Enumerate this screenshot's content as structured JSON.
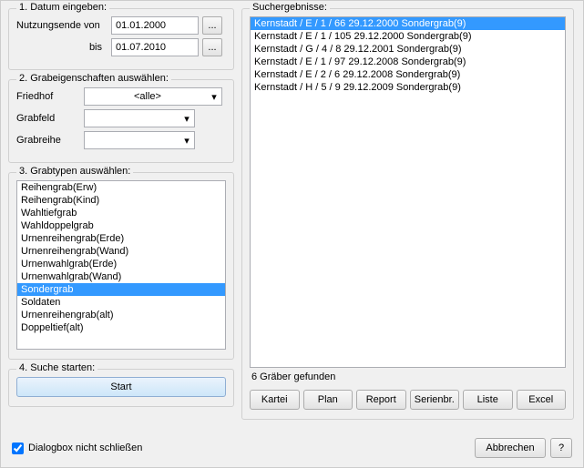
{
  "section1": {
    "title": "1. Datum eingeben:",
    "from_label": "Nutzungsende  von",
    "to_label": "bis",
    "from_value": "01.01.2000",
    "to_value": "01.07.2010",
    "browse": "..."
  },
  "section2": {
    "title": "2. Grabeigenschaften auswählen:",
    "friedhof_label": "Friedhof",
    "grabfeld_label": "Grabfeld",
    "grabreihe_label": "Grabreihe",
    "friedhof_value": "<alle>",
    "grabfeld_value": "",
    "grabreihe_value": ""
  },
  "section3": {
    "title": "3. Grabtypen auswählen:",
    "items": [
      "Reihengrab(Erw)",
      "Reihengrab(Kind)",
      "Wahltiefgrab",
      "Wahldoppelgrab",
      "Urnenreihengrab(Erde)",
      "Urnenreihengrab(Wand)",
      "Urnenwahlgrab(Erde)",
      "Urnenwahlgrab(Wand)",
      "Sondergrab",
      "Soldaten",
      "Urnenreihengrab(alt)",
      "Doppeltief(alt)"
    ],
    "selected_index": 8
  },
  "section4": {
    "title": "4. Suche starten:",
    "start": "Start"
  },
  "results": {
    "title": "Suchergebnisse:",
    "items": [
      "Kernstadt / E / 1 / 66   29.12.2000   Sondergrab(9)",
      "Kernstadt / E / 1 / 105   29.12.2000   Sondergrab(9)",
      "Kernstadt / G / 4 / 8   29.12.2001   Sondergrab(9)",
      "Kernstadt / E / 1 / 97   29.12.2008   Sondergrab(9)",
      "Kernstadt / E / 2 / 6   29.12.2008   Sondergrab(9)",
      "Kernstadt / H / 5 / 9   29.12.2009   Sondergrab(9)"
    ],
    "selected_index": 0,
    "count_label": "6 Gräber gefunden"
  },
  "buttons": {
    "kartei": "Kartei",
    "plan": "Plan",
    "report": "Report",
    "serienbr": "Serienbr.",
    "liste": "Liste",
    "excel": "Excel"
  },
  "footer": {
    "checkbox_label": "Dialogbox nicht schließen",
    "checkbox_checked": true,
    "abbrechen": "Abbrechen",
    "help": "?"
  }
}
